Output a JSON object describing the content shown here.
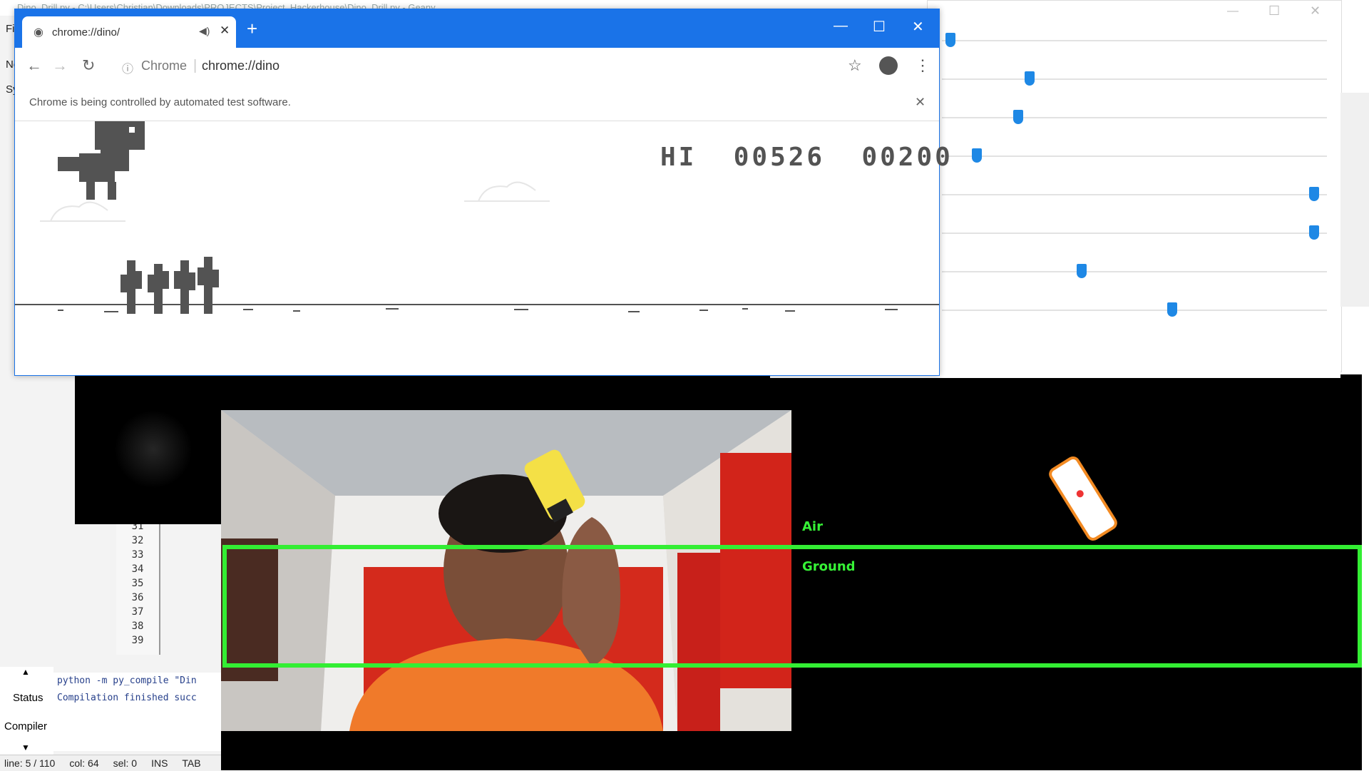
{
  "editor": {
    "title": "Dino_Drill.py - C:\\Users\\Christian\\Downloads\\PROJECTS\\Project_Hackerhouse\\Dino_Drill.py - Geany",
    "menu_fragments": [
      "Fi",
      "Ne",
      "Sy"
    ],
    "line_numbers": [
      "31",
      "32",
      "33",
      "34",
      "35",
      "36",
      "37",
      "38",
      "39"
    ],
    "side_tabs": {
      "status": "Status",
      "compiler": "Compiler"
    },
    "console_lines": [
      "python -m py_compile \"Din",
      "Compilation finished succ"
    ],
    "statusbar": {
      "line": "line: 5 / 110",
      "col": "col: 64",
      "sel": "sel: 0",
      "mode": "INS",
      "indent": "TAB"
    }
  },
  "chrome": {
    "tab_title": "chrome://dino/",
    "site_label": "Chrome",
    "url": "chrome://dino",
    "infobar_text": "Chrome is being controlled by automated test software.",
    "icons": [
      "globe-icon",
      "speaker-icon",
      "close-icon",
      "plus-icon",
      "minimize-icon",
      "maximize-icon",
      "close-icon",
      "back-icon",
      "forward-icon",
      "reload-icon",
      "star-icon",
      "account-icon",
      "menu-icon"
    ]
  },
  "game": {
    "hi_label": "HI",
    "high_score": "00526",
    "score": "00200"
  },
  "sliders": {
    "count": 8,
    "values": [
      0.01,
      0.22,
      0.19,
      0.08,
      0.98,
      0.98,
      0.36,
      0.6
    ]
  },
  "detection": {
    "air_label": "Air",
    "ground_label": "Ground",
    "zone_color": "#33ee33"
  }
}
